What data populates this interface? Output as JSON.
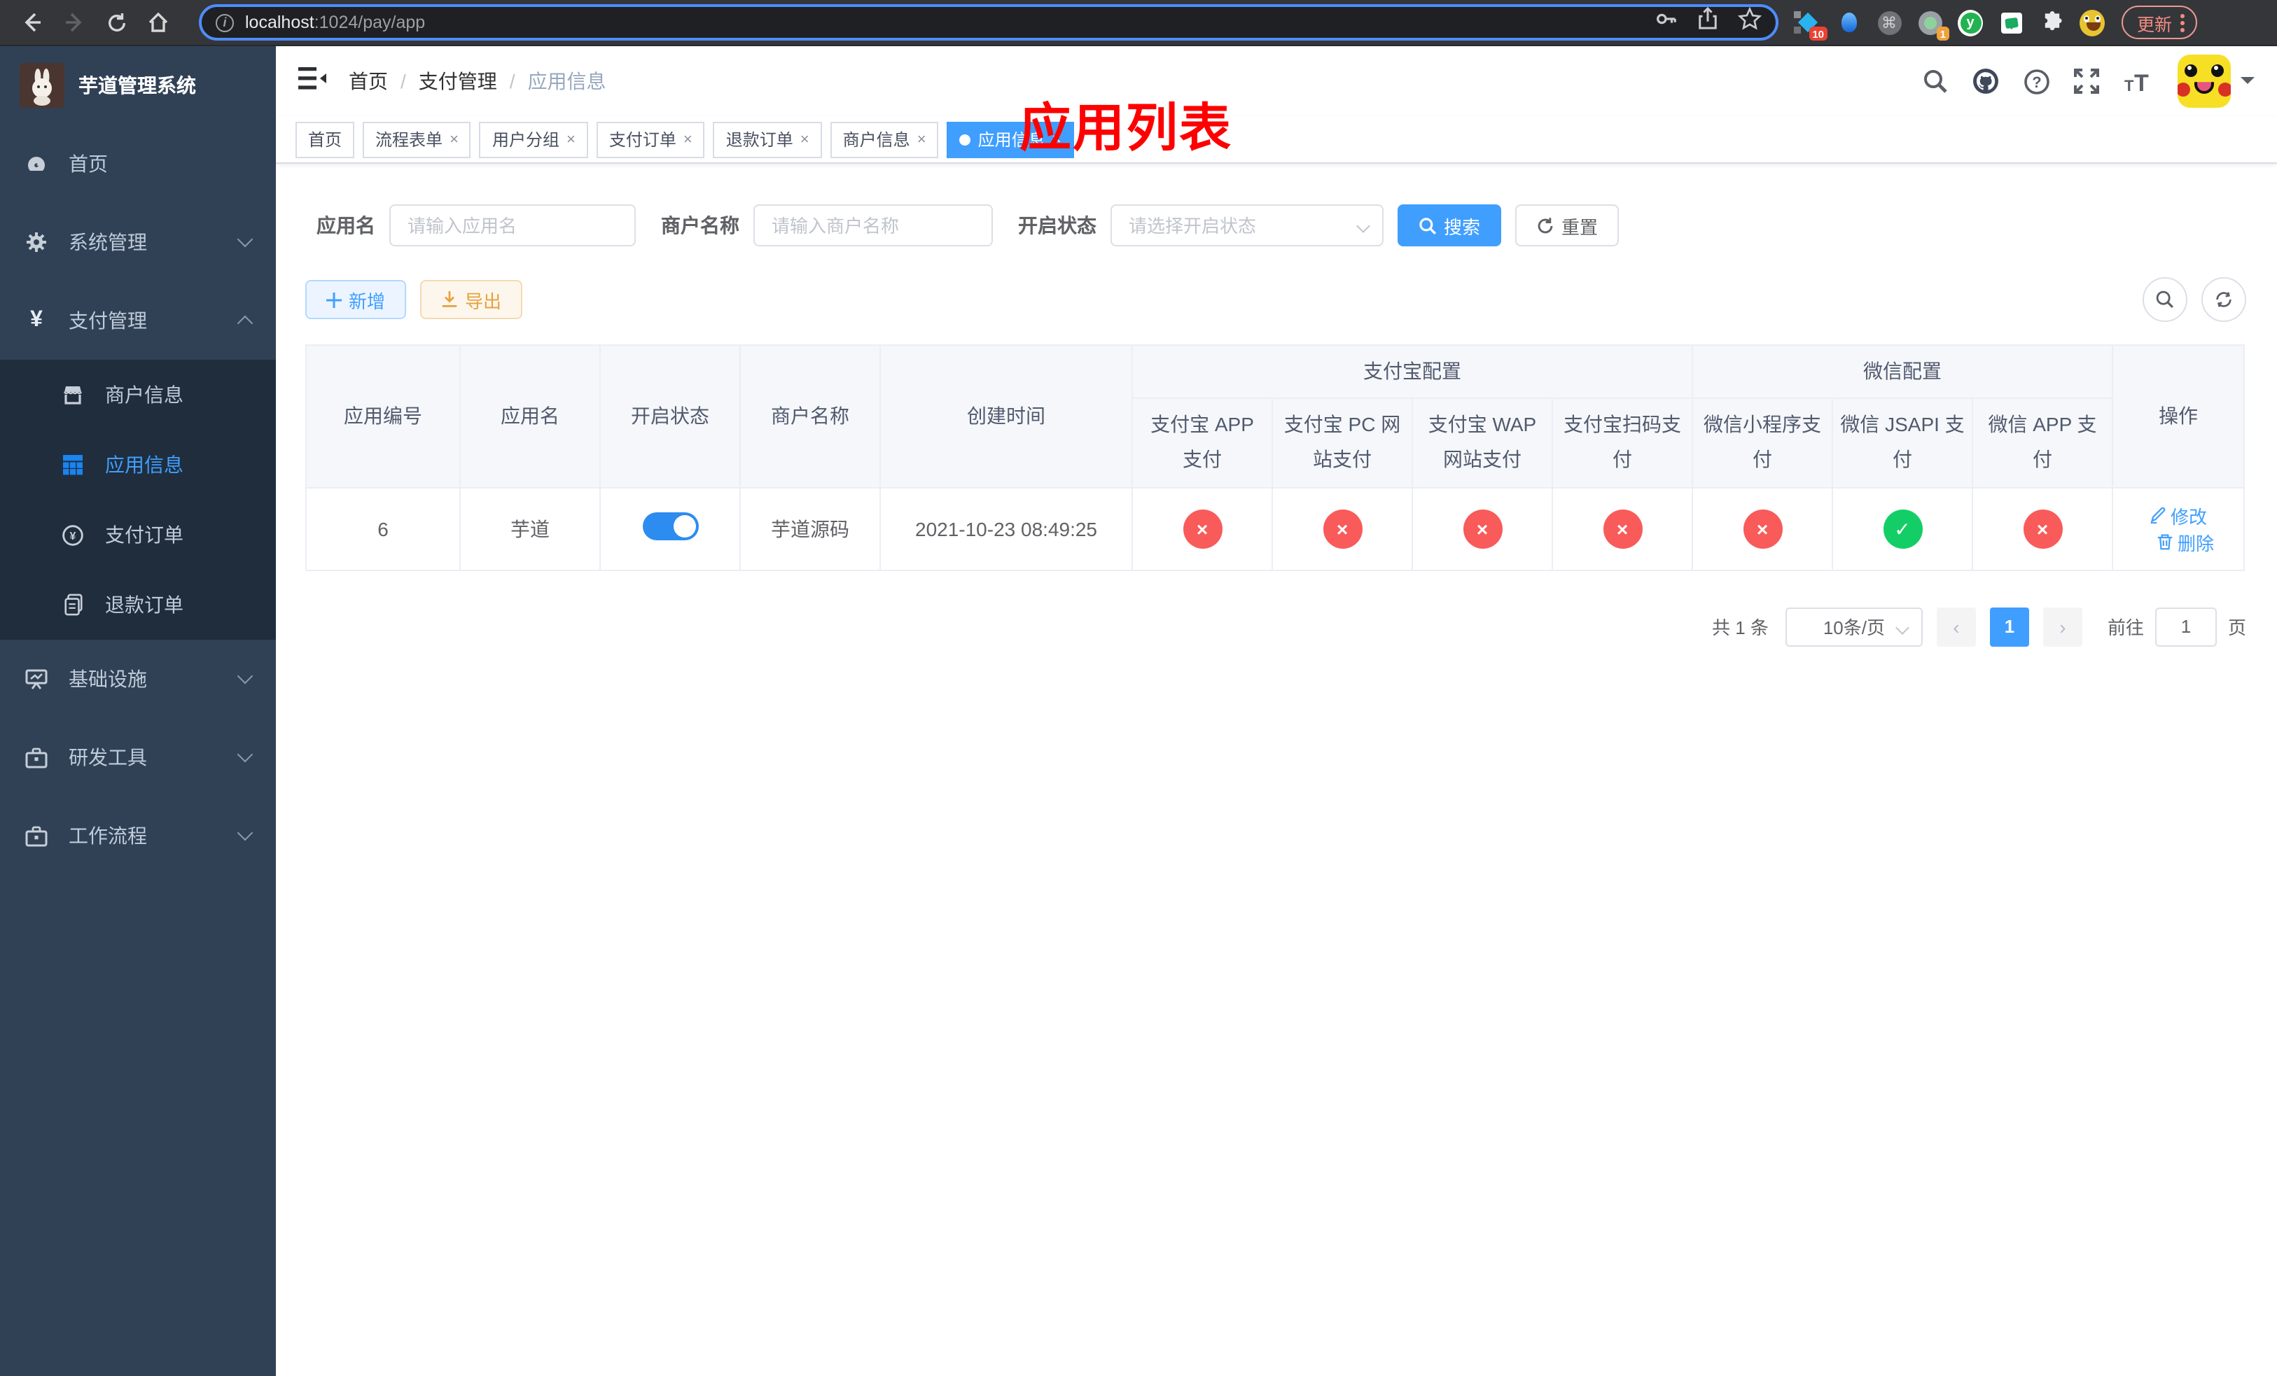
{
  "colors": {
    "accent": "#409eff",
    "success": "#13ce66",
    "danger": "#f95a5a",
    "warning": "#e6a23c",
    "sidebar_bg": "#304156",
    "submenu_bg": "#1f2d3d",
    "annotation_red": "#fe0000"
  },
  "browser": {
    "url_host": "localhost",
    "url_path": ":1024/pay/app",
    "update_label": "更新",
    "extension_badge_1": "10",
    "extension_badge_2": "1"
  },
  "sidebar": {
    "title": "芋道管理系统",
    "items": [
      {
        "label": "首页"
      },
      {
        "label": "系统管理"
      },
      {
        "label": "支付管理"
      },
      {
        "label": "基础设施"
      },
      {
        "label": "研发工具"
      },
      {
        "label": "工作流程"
      }
    ],
    "pay_children": [
      {
        "label": "商户信息"
      },
      {
        "label": "应用信息"
      },
      {
        "label": "支付订单"
      },
      {
        "label": "退款订单"
      }
    ]
  },
  "header": {
    "breadcrumb": {
      "0": "首页",
      "1": "支付管理",
      "2": "应用信息"
    },
    "annotation": "应用列表"
  },
  "tabs": [
    {
      "label": "首页"
    },
    {
      "label": "流程表单"
    },
    {
      "label": "用户分组"
    },
    {
      "label": "支付订单"
    },
    {
      "label": "退款订单"
    },
    {
      "label": "商户信息"
    },
    {
      "label": "应用信息"
    }
  ],
  "filters": {
    "app_name_label": "应用名",
    "app_name_placeholder": "请输入应用名",
    "merchant_label": "商户名称",
    "merchant_placeholder": "请输入商户名称",
    "status_label": "开启状态",
    "status_placeholder": "请选择开启状态",
    "search_label": "搜索",
    "reset_label": "重置"
  },
  "toolbar": {
    "add_label": "新增",
    "export_label": "导出"
  },
  "table": {
    "columns": {
      "0": "应用编号",
      "1": "应用名",
      "2": "开启状态",
      "3": "商户名称",
      "4": "创建时间",
      "ops": "操作"
    },
    "groups": {
      "alipay": "支付宝配置",
      "wechat": "微信配置"
    },
    "sub_columns": {
      "0": "支付宝 APP 支付",
      "1": "支付宝 PC 网站支付",
      "2": "支付宝 WAP 网站支付",
      "3": "支付宝扫码支付",
      "4": "微信小程序支付",
      "5": "微信 JSAPI 支付",
      "6": "微信 APP 支付"
    },
    "row": {
      "id": "6",
      "name": "芋道",
      "enabled": true,
      "merchant": "芋道源码",
      "created_at": "2021-10-23 08:49:25",
      "statuses": [
        false,
        false,
        false,
        false,
        false,
        true,
        false
      ],
      "edit_label": "修改",
      "delete_label": "删除"
    }
  },
  "pagination": {
    "total": "共 1 条",
    "page_size": "10条/页",
    "current_page": "1",
    "goto_label": "前往",
    "goto_value": "1",
    "page_unit": "页"
  }
}
